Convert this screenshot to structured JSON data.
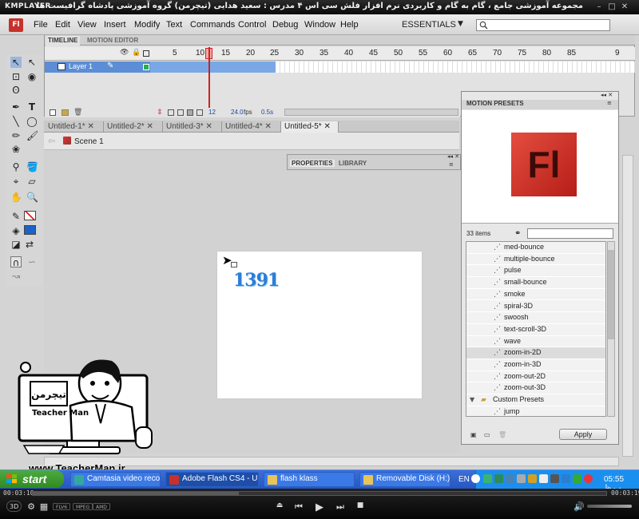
{
  "player": {
    "logo": "KMPLAYER",
    "caption": "مجموعه آموزشی جامع ، گام به گام و کاربردی نرم افزار فلش سی اس ۴ مدرس : سعید هدایی (تیچرمن) گروه آموزشی پادشاه گرافیست ها",
    "time_elapsed": "00:03:10",
    "time_total": "00:03:19",
    "progress": 0.36,
    "labels": [
      "FLV6",
      "MPEG",
      "AMD",
      "3D"
    ]
  },
  "flash": {
    "logo": "Fl",
    "menu": [
      "File",
      "Edit",
      "View",
      "Insert",
      "Modify",
      "Text",
      "Commands",
      "Control",
      "Debug",
      "Window",
      "Help"
    ],
    "workspace": "ESSENTIALS",
    "timeline": {
      "tabs": [
        "TIMELINE",
        "MOTION EDITOR"
      ],
      "frame_numbers": [
        "5",
        "10",
        "15",
        "20",
        "25",
        "30",
        "35",
        "40",
        "45",
        "50",
        "55",
        "60",
        "65",
        "70",
        "75",
        "80",
        "85",
        "9"
      ],
      "layer": "Layer 1",
      "current_frame": "12",
      "fps": "24.0",
      "fps_unit": "fps",
      "time": "0.5s"
    },
    "doc_tabs": [
      "Untitled-1*",
      "Untitled-2*",
      "Untitled-3*",
      "Untitled-4*",
      "Untitled-5*"
    ],
    "active_doc": 4,
    "scene": "Scene 1",
    "stage_text": "1391",
    "props_tabs": [
      "PROPERTIES",
      "LIBRARY"
    ],
    "motion_presets": {
      "title": "MOTION PRESETS",
      "count": "33 items",
      "items": [
        {
          "label": "med-bounce",
          "folder": false
        },
        {
          "label": "multiple-bounce",
          "folder": false
        },
        {
          "label": "pulse",
          "folder": false
        },
        {
          "label": "small-bounce",
          "folder": false
        },
        {
          "label": "smoke",
          "folder": false
        },
        {
          "label": "spiral-3D",
          "folder": false
        },
        {
          "label": "swoosh",
          "folder": false
        },
        {
          "label": "text-scroll-3D",
          "folder": false
        },
        {
          "label": "wave",
          "folder": false
        },
        {
          "label": "zoom-in-2D",
          "folder": false,
          "selected": true
        },
        {
          "label": "zoom-in-3D",
          "folder": false
        },
        {
          "label": "zoom-out-2D",
          "folder": false
        },
        {
          "label": "zoom-out-3D",
          "folder": false
        },
        {
          "label": "Custom Presets",
          "folder": true
        },
        {
          "label": "jump",
          "folder": false
        }
      ],
      "apply_label": "Apply"
    }
  },
  "watermark": {
    "url": "www.TeacherMan.ir",
    "name": "Teacher Man"
  },
  "taskbar": {
    "start": "start",
    "tasks": [
      "Camtasia video reco...",
      "Adobe Flash CS4 - U...",
      "flash klass",
      "Removable Disk (H:)"
    ],
    "active_task": 1,
    "lang": "EN",
    "clock": "05:55 ب.ظ"
  },
  "colors": {
    "accent_flash": "#c8312b",
    "layer_selected": "#5b8ed6",
    "playhead": "#cc2222",
    "taskbar": "#2556c2",
    "start_green": "#3e9a30"
  }
}
